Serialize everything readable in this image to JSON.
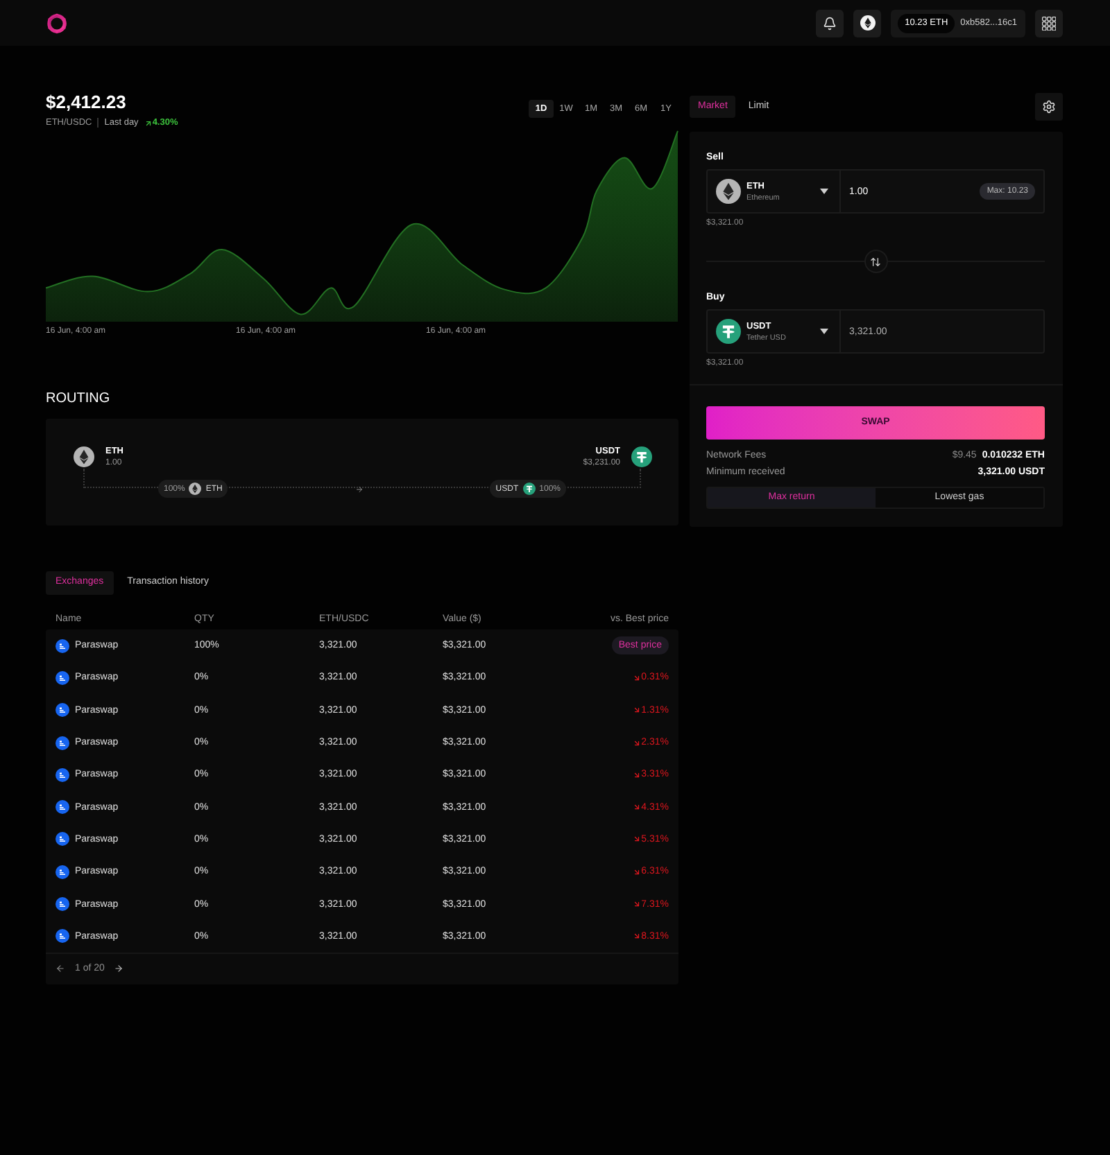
{
  "top_bar": {
    "wallet": {
      "balance": "10.23 ETH",
      "address": "0xb582...16c1"
    }
  },
  "price": {
    "value": "$2,412.23",
    "pair": "ETH/USDC",
    "period": "Last day",
    "change": "4.30%",
    "up": true
  },
  "timeframes": [
    {
      "label": "1D",
      "selected": true
    },
    {
      "label": "1W",
      "selected": false
    },
    {
      "label": "1M",
      "selected": false
    },
    {
      "label": "3M",
      "selected": false
    },
    {
      "label": "6M",
      "selected": false
    },
    {
      "label": "1Y",
      "selected": false
    }
  ],
  "chart": {
    "x_labels": [
      "16 Jun, 4:00 am",
      "16 Jun, 4:00 am",
      "16 Jun, 4:00 am"
    ]
  },
  "routing": {
    "title": "ROUTING",
    "from": {
      "symbol": "ETH",
      "amount": "1.00"
    },
    "to": {
      "symbol": "USDT",
      "amount": "$3,231.00"
    },
    "hops": [
      {
        "kind": "source",
        "share": "100%",
        "token": "ETH"
      },
      {
        "kind": "target",
        "share": "100%",
        "token": "USDT"
      }
    ]
  },
  "trade": {
    "tabs": [
      {
        "label": "Market",
        "selected": true
      },
      {
        "label": "Limit",
        "selected": false
      }
    ],
    "sell": {
      "label": "Sell",
      "symbol": "ETH",
      "name": "Ethereum",
      "amount": "1.00",
      "readonly": false,
      "max": "Max: 10.23",
      "usd": "$3,321.00"
    },
    "buy": {
      "label": "Buy",
      "symbol": "USDT",
      "name": "Tether USD",
      "amount": "3,321.00",
      "readonly": true,
      "usd": "$3,321.00"
    },
    "swap_button": "SWAP",
    "details": [
      {
        "label": "Network Fees",
        "secondary": "$9.45",
        "value": "0.010232 ETH"
      },
      {
        "label": "Minimum received",
        "value": "3,321.00 USDT"
      }
    ],
    "route_options": [
      {
        "label": "Max return",
        "selected": true
      },
      {
        "label": "Lowest gas",
        "selected": false
      }
    ]
  },
  "history": {
    "tabs": [
      {
        "label": "Exchanges",
        "selected": true
      },
      {
        "label": "Transaction history",
        "selected": false
      }
    ],
    "columns": [
      "Name",
      "QTY",
      "ETH/USDC",
      "Value ($)",
      "vs. Best price"
    ],
    "rows": [
      {
        "name": "Paraswap",
        "qty": "100%",
        "rate": "3,321.00",
        "value": "$3,321.00",
        "vs_best": {
          "kind": "best",
          "text": "Best price"
        }
      },
      {
        "name": "Paraswap",
        "qty": "0%",
        "rate": "3,321.00",
        "value": "$3,321.00",
        "vs_best": {
          "kind": "down",
          "text": "0.31%"
        }
      },
      {
        "name": "Paraswap",
        "qty": "0%",
        "rate": "3,321.00",
        "value": "$3,321.00",
        "vs_best": {
          "kind": "down",
          "text": "1.31%"
        }
      },
      {
        "name": "Paraswap",
        "qty": "0%",
        "rate": "3,321.00",
        "value": "$3,321.00",
        "vs_best": {
          "kind": "down",
          "text": "2.31%"
        }
      },
      {
        "name": "Paraswap",
        "qty": "0%",
        "rate": "3,321.00",
        "value": "$3,321.00",
        "vs_best": {
          "kind": "down",
          "text": "3.31%"
        }
      },
      {
        "name": "Paraswap",
        "qty": "0%",
        "rate": "3,321.00",
        "value": "$3,321.00",
        "vs_best": {
          "kind": "down",
          "text": "4.31%"
        }
      },
      {
        "name": "Paraswap",
        "qty": "0%",
        "rate": "3,321.00",
        "value": "$3,321.00",
        "vs_best": {
          "kind": "down",
          "text": "5.31%"
        }
      },
      {
        "name": "Paraswap",
        "qty": "0%",
        "rate": "3,321.00",
        "value": "$3,321.00",
        "vs_best": {
          "kind": "down",
          "text": "6.31%"
        }
      },
      {
        "name": "Paraswap",
        "qty": "0%",
        "rate": "3,321.00",
        "value": "$3,321.00",
        "vs_best": {
          "kind": "down",
          "text": "7.31%"
        }
      },
      {
        "name": "Paraswap",
        "qty": "0%",
        "rate": "3,321.00",
        "value": "$3,321.00",
        "vs_best": {
          "kind": "down",
          "text": "8.31%"
        }
      }
    ],
    "pagination": "1 of 20"
  }
}
